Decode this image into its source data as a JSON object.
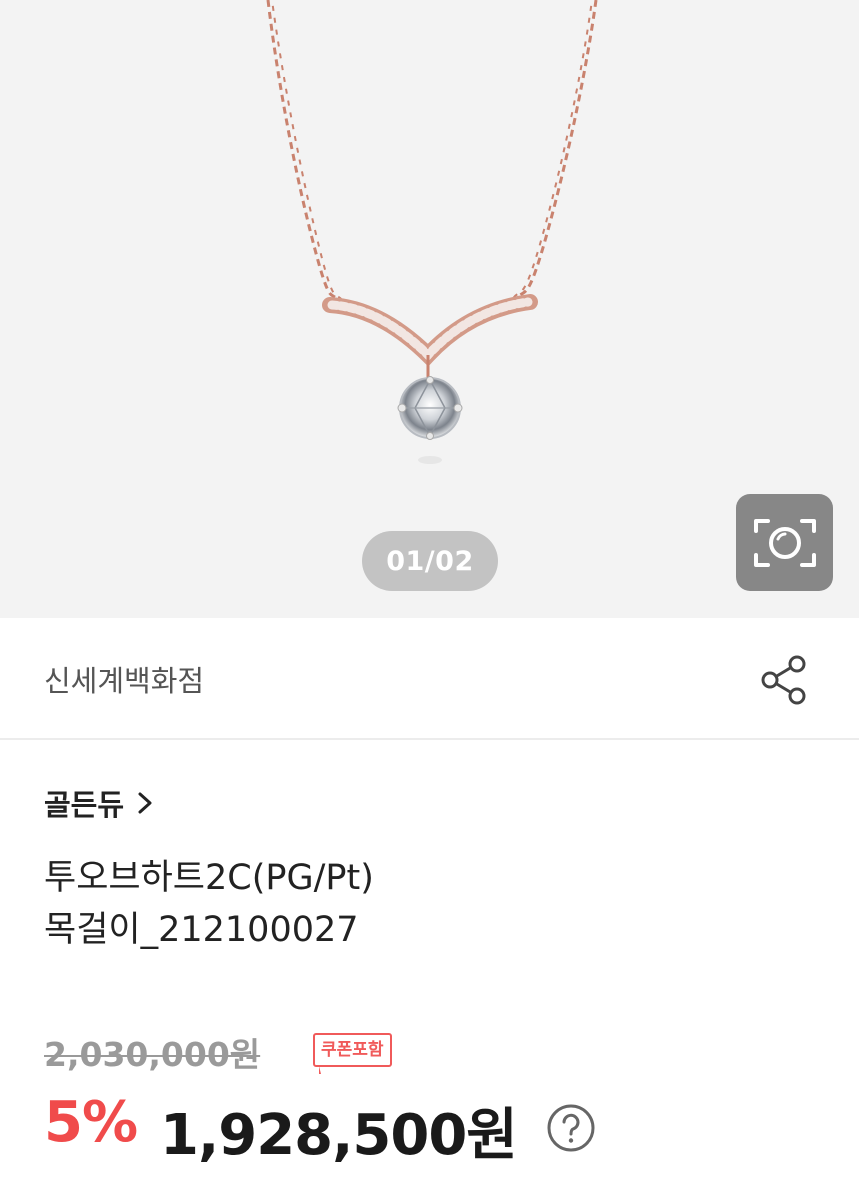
{
  "gallery": {
    "page_indicator": "01/02",
    "lens_icon": "image-search-icon"
  },
  "seller": {
    "name": "신세계백화점",
    "share_icon": "share-icon"
  },
  "product": {
    "brand": "골든듀",
    "brand_chevron_icon": "chevron-right-icon",
    "title_line1": "투오브하트2C(PG/Pt)",
    "title_line2": "목걸이_212100027"
  },
  "price": {
    "original": "2,030,000원",
    "coupon_badge": "쿠폰포함",
    "discount_rate": "5%",
    "sale_price": "1,928,500원",
    "help_icon": "question-mark-icon"
  },
  "colors": {
    "discount": "#f04b4b",
    "coupon": "#f05a5a",
    "chain": "#c9826e"
  }
}
